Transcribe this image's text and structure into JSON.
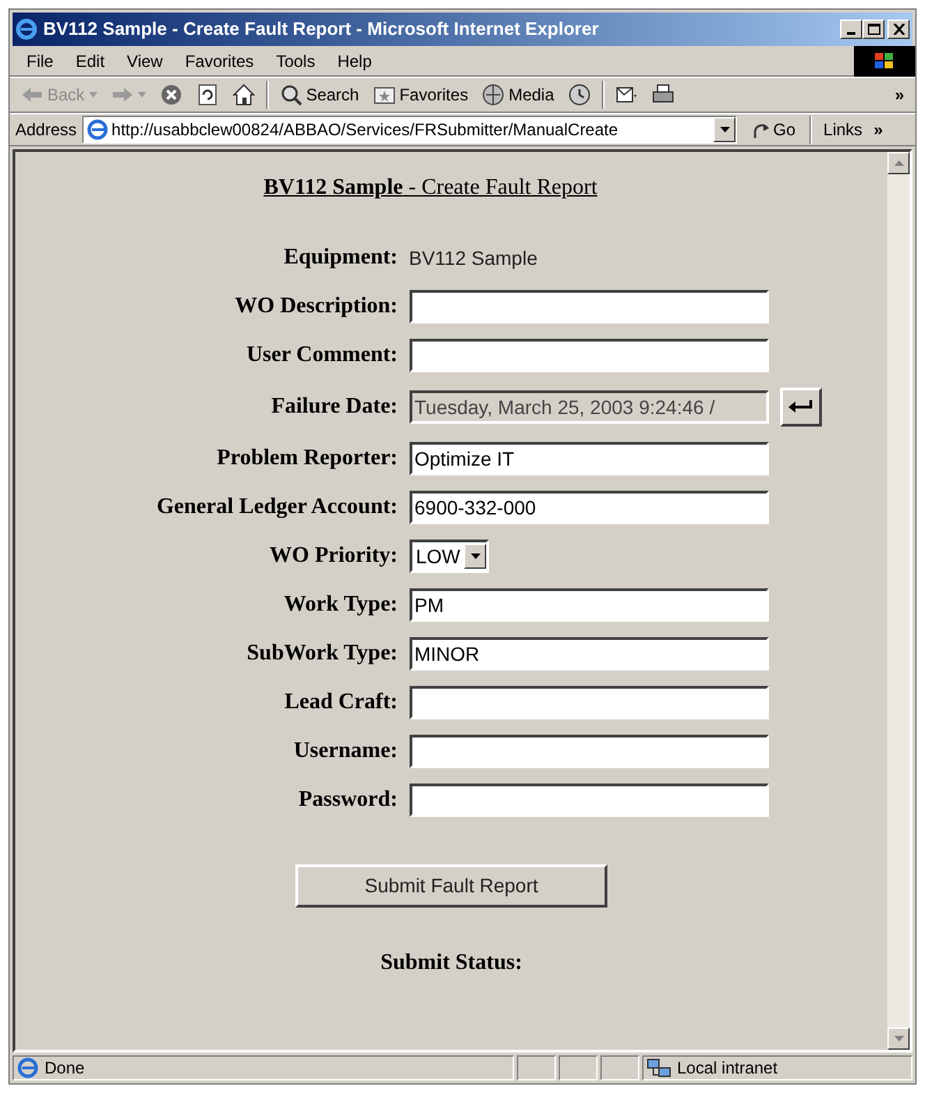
{
  "window": {
    "title": "BV112 Sample - Create Fault Report - Microsoft Internet Explorer"
  },
  "menu": [
    "File",
    "Edit",
    "View",
    "Favorites",
    "Tools",
    "Help"
  ],
  "toolbar": [
    {
      "kind": "back",
      "label": "Back",
      "disabled": true
    },
    {
      "kind": "forward",
      "disabled": true
    },
    {
      "kind": "stop"
    },
    {
      "kind": "refresh"
    },
    {
      "kind": "home"
    },
    {
      "kind": "sep"
    },
    {
      "kind": "search",
      "label": "Search"
    },
    {
      "kind": "favorites",
      "label": "Favorites"
    },
    {
      "kind": "media",
      "label": "Media"
    },
    {
      "kind": "history"
    },
    {
      "kind": "sep"
    },
    {
      "kind": "mail"
    },
    {
      "kind": "print"
    },
    {
      "kind": "more",
      "label": "»"
    }
  ],
  "address_bar": {
    "label": "Address",
    "url": "http://usabbclew00824/ABBAO/Services/FRSubmitter/ManualCreate",
    "go": "Go",
    "links": "Links",
    "links_more": "»"
  },
  "page": {
    "heading": "**BV112 Sample** - Create Fault Report",
    "fields": [
      {
        "kind": "static",
        "label": "Equipment:",
        "value": "BV112 Sample"
      },
      {
        "kind": "text",
        "label": "WO Description:"
      },
      {
        "kind": "text",
        "label": "User Comment:"
      },
      {
        "kind": "text",
        "label": "Failure Date:",
        "value": "Tuesday, March 25, 2003 9:24:46 /",
        "disabled": true,
        "reset_button": true
      },
      {
        "kind": "text",
        "label": "Problem Reporter:",
        "value": "Optimize IT"
      },
      {
        "kind": "text",
        "label": "General Ledger Account:",
        "value": "6900-332-000"
      },
      {
        "kind": "select",
        "label": "WO Priority:",
        "value": "LOW"
      },
      {
        "kind": "text",
        "label": "Work Type:",
        "value": "PM"
      },
      {
        "kind": "text",
        "label": "SubWork Type:",
        "value": "MINOR"
      },
      {
        "kind": "text",
        "label": "Lead Craft:"
      },
      {
        "kind": "text",
        "label": "Username:"
      },
      {
        "kind": "text",
        "label": "Password:"
      }
    ],
    "submit": "Submit Fault Report",
    "status_label": "Submit Status:"
  },
  "status_bar": {
    "text": "Done",
    "zone": "Local intranet"
  }
}
